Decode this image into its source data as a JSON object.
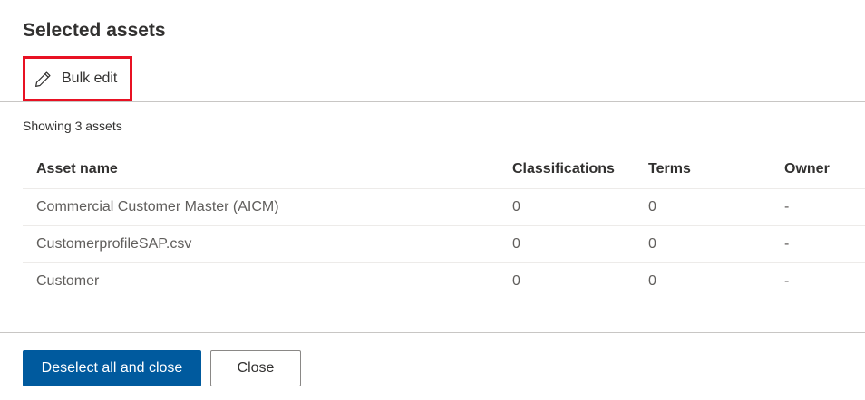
{
  "panel": {
    "title": "Selected assets"
  },
  "toolbar": {
    "bulk_edit_label": "Bulk edit",
    "bulk_edit_icon": "pencil-icon",
    "highlight_color": "#e81123"
  },
  "summary": {
    "showing_text": "Showing 3 assets"
  },
  "table": {
    "columns": {
      "name": "Asset name",
      "classifications": "Classifications",
      "terms": "Terms",
      "owner": "Owner"
    },
    "rows": [
      {
        "name": "Commercial Customer Master (AICM)",
        "classifications": "0",
        "terms": "0",
        "owner": "-"
      },
      {
        "name": "CustomerprofileSAP.csv",
        "classifications": "0",
        "terms": "0",
        "owner": "-"
      },
      {
        "name": "Customer",
        "classifications": "0",
        "terms": "0",
        "owner": "-"
      }
    ]
  },
  "footer": {
    "deselect_label": "Deselect all and close",
    "close_label": "Close",
    "primary_color": "#005a9e"
  }
}
